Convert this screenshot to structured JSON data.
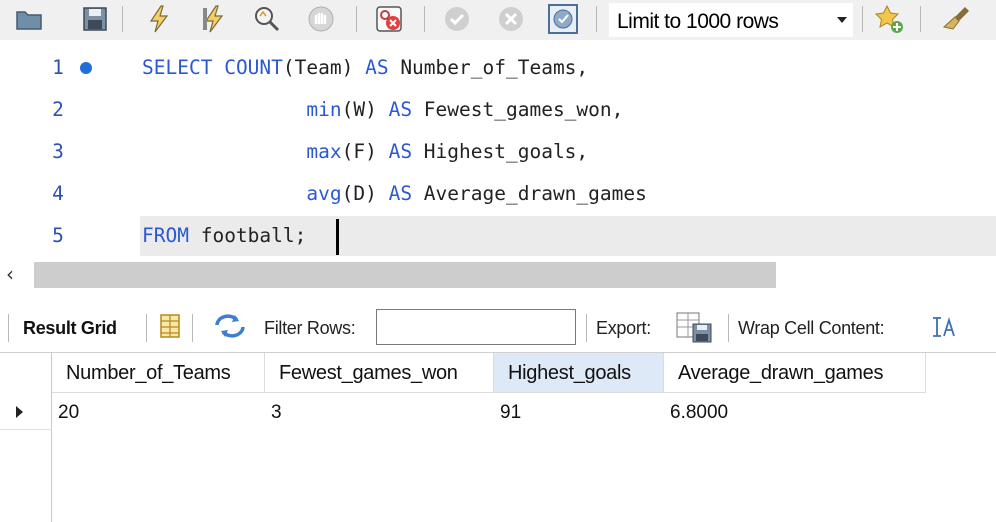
{
  "toolbar": {
    "icons": [
      "open-folder-icon",
      "save-icon",
      "execute-icon",
      "execute-current-icon",
      "explain-icon",
      "stop-icon",
      "toggle-error-icon",
      "commit-icon",
      "rollback-icon",
      "autocommit-icon",
      "add-snippet-icon",
      "beautify-icon"
    ],
    "limit_select": "Limit to 1000 rows"
  },
  "editor": {
    "lines": [
      {
        "num": "1",
        "code": "SELECT COUNT(Team) AS Number_of_Teams,"
      },
      {
        "num": "2",
        "code": "min(W) AS Fewest_games_won,"
      },
      {
        "num": "3",
        "code": "max(F) AS Highest_goals,"
      },
      {
        "num": "4",
        "code": "avg(D) AS Average_drawn_games"
      },
      {
        "num": "5",
        "code": "FROM football;"
      }
    ]
  },
  "result_bar": {
    "result_grid_label": "Result Grid",
    "filter_rows_label": "Filter Rows:",
    "filter_value": "",
    "export_label": "Export:",
    "wrap_label": "Wrap Cell Content:"
  },
  "grid": {
    "columns": [
      "Number_of_Teams",
      "Fewest_games_won",
      "Highest_goals",
      "Average_drawn_games"
    ],
    "rows": [
      [
        "20",
        "3",
        "91",
        "6.8000"
      ]
    ]
  }
}
